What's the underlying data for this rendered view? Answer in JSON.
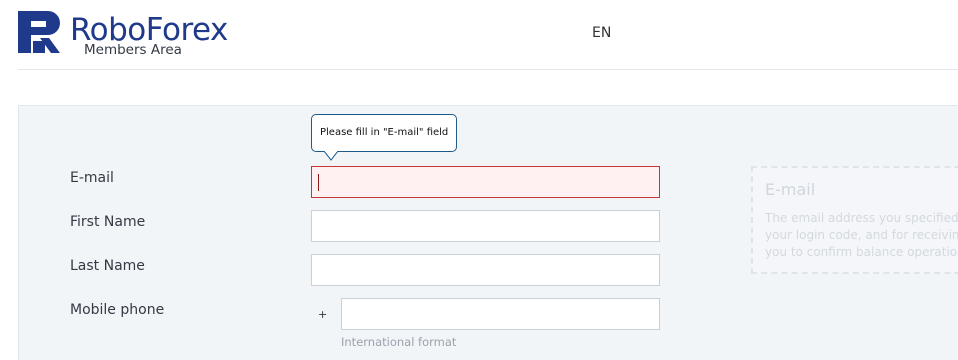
{
  "header": {
    "brand_name": "RoboForex",
    "brand_subtitle": "Members Area",
    "language": "EN"
  },
  "form": {
    "email": {
      "label": "E-mail",
      "value": "",
      "error_tooltip": "Please fill in \"E-mail\" field"
    },
    "first_name": {
      "label": "First Name",
      "value": ""
    },
    "last_name": {
      "label": "Last Name",
      "value": ""
    },
    "mobile_phone": {
      "label": "Mobile phone",
      "prefix": "+",
      "value": "",
      "hint": "International format"
    }
  },
  "help": {
    "title": "E-mail",
    "lines": [
      "The email address you specified",
      "your login code, and for receivin",
      "you to confirm balance operatio"
    ]
  },
  "colors": {
    "brand": "#1f3a8a",
    "error_border": "#c93535",
    "error_background": "#fff1f1",
    "tooltip_border": "#1f5b8a",
    "panel_background": "#f2f5f8"
  },
  "icons": {
    "logo": "roboforex-logo-icon"
  }
}
